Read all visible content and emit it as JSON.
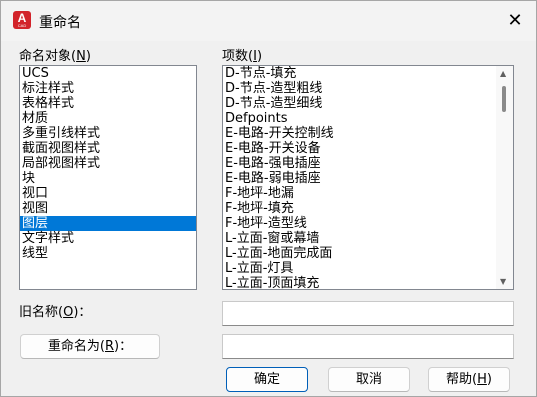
{
  "window": {
    "title": "重命名",
    "icon_letter": "A",
    "icon_sub": "CAD",
    "close_glyph": "✕"
  },
  "left_panel": {
    "label": "命名对象",
    "label_key": "N",
    "items": [
      "UCS",
      "标注样式",
      "表格样式",
      "材质",
      "多重引线样式",
      "截面视图样式",
      "局部视图样式",
      "块",
      "视口",
      "视图",
      "图层",
      "文字样式",
      "线型"
    ],
    "selected_index": 10
  },
  "right_panel": {
    "label": "项数",
    "label_key": "I",
    "items": [
      "D-节点-填充",
      "D-节点-造型粗线",
      "D-节点-造型细线",
      "Defpoints",
      "E-电路-开关控制线",
      "E-电路-开关设备",
      "E-电路-强电插座",
      "E-电路-弱电插座",
      "F-地坪-地漏",
      "F-地坪-填充",
      "F-地坪-造型线",
      "L-立面-窗或幕墙",
      "L-立面-地面完成面",
      "L-立面-灯具",
      "L-立面-顶面填充"
    ],
    "scrollbar_icon": "scrollbar"
  },
  "old_name": {
    "label": "旧名称",
    "label_key": "O",
    "value": ""
  },
  "rename_to": {
    "label": "重命名为",
    "label_key": "R",
    "value": ""
  },
  "buttons": {
    "ok": "确定",
    "cancel": "取消",
    "help": "帮助",
    "help_key": "H"
  },
  "colors": {
    "selection": "#0078d7",
    "icon_red": "#d2232a",
    "default_border": "#005fb8"
  }
}
